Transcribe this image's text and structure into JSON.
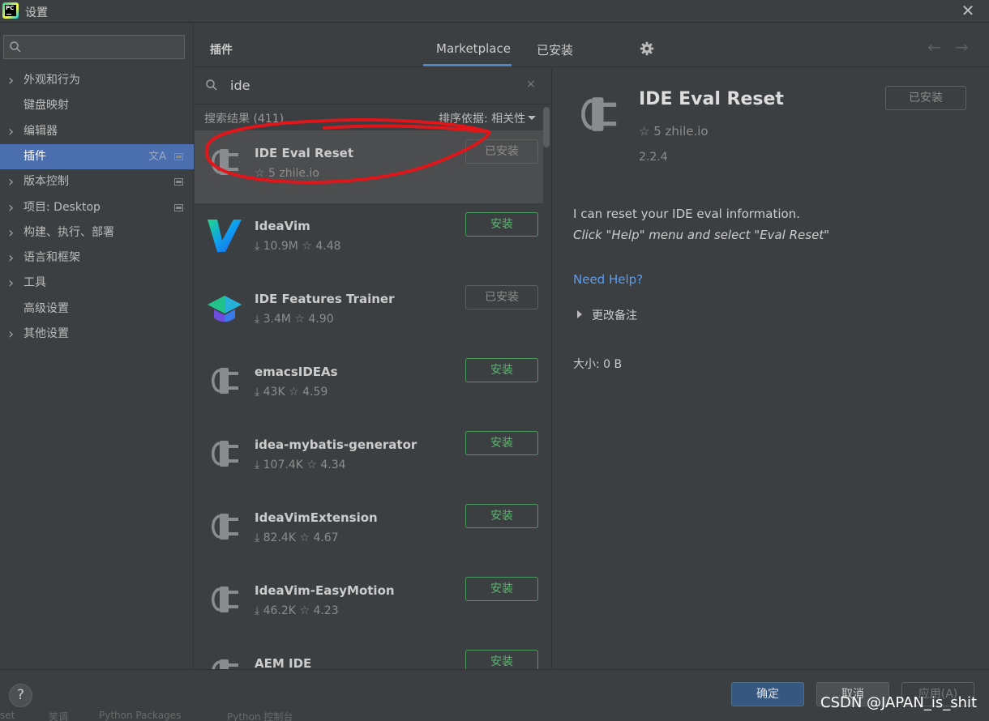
{
  "window": {
    "title": "设置",
    "app_icon": "pycharm-icon",
    "app_icon_text": "PC",
    "close_glyph": "✕"
  },
  "sidebar": {
    "search_placeholder": "",
    "items": [
      {
        "label": "外观和行为",
        "has_arrow": true
      },
      {
        "label": "键盘映射",
        "has_arrow": false
      },
      {
        "label": "编辑器",
        "has_arrow": true
      },
      {
        "label": "插件",
        "has_arrow": false,
        "selected": true,
        "translate_glyph": "文A"
      },
      {
        "label": "版本控制",
        "has_arrow": true
      },
      {
        "label": "项目: Desktop",
        "has_arrow": true
      },
      {
        "label": "构建、执行、部署",
        "has_arrow": true
      },
      {
        "label": "语言和框架",
        "has_arrow": true
      },
      {
        "label": "工具",
        "has_arrow": true
      },
      {
        "label": "高级设置",
        "has_arrow": false
      },
      {
        "label": "其他设置",
        "has_arrow": true
      }
    ]
  },
  "header": {
    "title": "插件",
    "tabs": [
      {
        "label": "Marketplace",
        "active": true
      },
      {
        "label": "已安装",
        "active": false
      }
    ],
    "back_glyph": "←",
    "forward_glyph": "→"
  },
  "search": {
    "query": "ide",
    "results_label": "搜索结果 (411)",
    "sort_label": "排序依据: 相关性",
    "clear_glyph": "×"
  },
  "plugins": [
    {
      "name": "IDE Eval Reset",
      "meta": "☆ 5   zhile.io",
      "button": "已安装",
      "state": "installed",
      "icon": "plugin-plug-icon",
      "selected": true
    },
    {
      "name": "IdeaVim",
      "meta": "⤓ 10.9M   ☆ 4.48",
      "button": "安装",
      "state": "install",
      "icon": "ideavim-logo-icon"
    },
    {
      "name": "IDE Features Trainer",
      "meta": "⤓ 3.4M   ☆ 4.90",
      "button": "已安装",
      "state": "installed",
      "icon": "graduation-cap-icon"
    },
    {
      "name": "emacsIDEAs",
      "meta": "⤓ 43K   ☆ 4.59",
      "button": "安装",
      "state": "install",
      "icon": "plugin-plug-icon"
    },
    {
      "name": "idea-mybatis-generator",
      "meta": "⤓ 107.4K   ☆ 4.34",
      "button": "安装",
      "state": "install",
      "icon": "plugin-plug-icon"
    },
    {
      "name": "IdeaVimExtension",
      "meta": "⤓ 82.4K   ☆ 4.67",
      "button": "安装",
      "state": "install",
      "icon": "plugin-plug-icon"
    },
    {
      "name": "IdeaVim-EasyMotion",
      "meta": "⤓ 46.2K   ☆ 4.23",
      "button": "安装",
      "state": "install",
      "icon": "plugin-plug-icon"
    },
    {
      "name": "AEM IDE",
      "meta": "",
      "button": "安装",
      "state": "install",
      "icon": "plugin-plug-icon"
    }
  ],
  "detail": {
    "name": "IDE Eval Reset",
    "meta": "☆ 5   zhile.io",
    "version": "2.2.4",
    "button": "已安装",
    "description_line1": "I can reset your IDE eval information.",
    "description_line2": "Click \"Help\" menu and select \"Eval Reset\"",
    "help_link": "Need Help?",
    "change_notes": "更改备注",
    "size": "大小: 0 B"
  },
  "footer": {
    "help_glyph": "?",
    "ok": "确定",
    "cancel": "取消",
    "apply": "应用(A)",
    "taskbar_items": [
      "set",
      "笑调",
      "Python Packages",
      "Python 控制台"
    ],
    "watermark": "CSDN @JAPAN_is_shit"
  },
  "colors": {
    "background": "#3c3f41",
    "selection": "#4b6eaf",
    "install_green": "#5bb56e",
    "link_blue": "#589df6",
    "annotation_red": "#e0161b"
  }
}
